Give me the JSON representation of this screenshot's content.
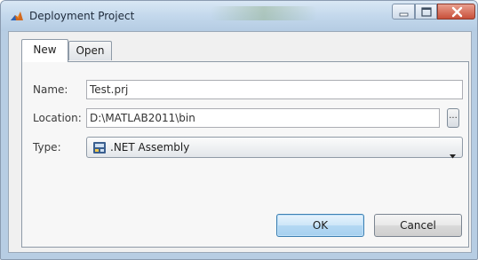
{
  "window": {
    "title": "Deployment Project",
    "controls": {
      "minimize_icon": "minimize-icon",
      "maximize_icon": "maximize-icon",
      "close_icon": "close-icon"
    }
  },
  "tabs": [
    {
      "label": "New",
      "selected": true
    },
    {
      "label": "Open",
      "selected": false
    }
  ],
  "form": {
    "name_label": "Name:",
    "name_value": "Test.prj",
    "location_label": "Location:",
    "location_value": "D:\\MATLAB2011\\bin",
    "browse_label": "...",
    "type_label": "Type:",
    "type_value": ".NET Assembly",
    "type_icon": "assembly-icon"
  },
  "buttons": {
    "ok_label": "OK",
    "cancel_label": "Cancel"
  },
  "colors": {
    "ok_border": "#3c7fb1",
    "close_button": "#c8503a",
    "titlebar": "#c3d8ec"
  }
}
